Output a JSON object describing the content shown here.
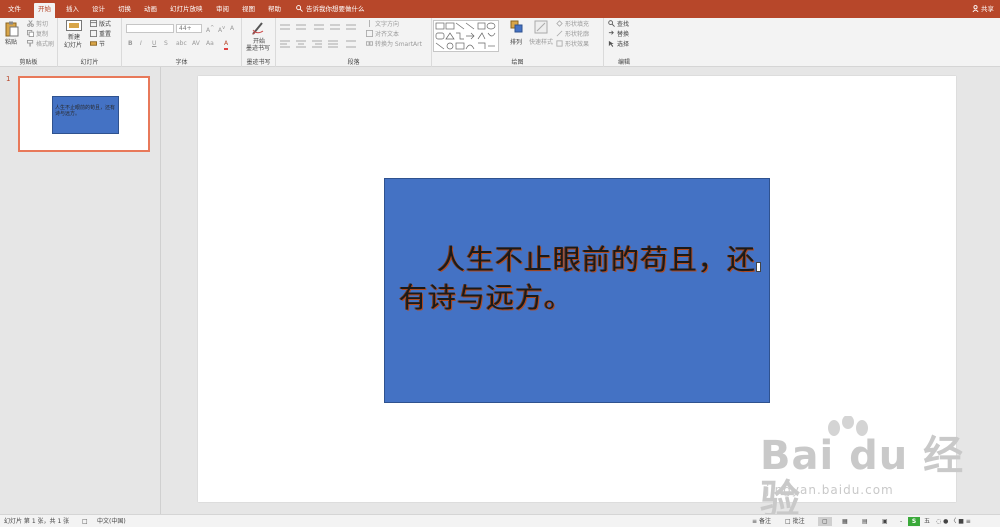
{
  "tabs": [
    "文件",
    "开始",
    "插入",
    "设计",
    "切换",
    "动画",
    "幻灯片放映",
    "审阅",
    "视图",
    "帮助"
  ],
  "active_tab": "开始",
  "tell_me": "告诉我你想要做什么",
  "share": "共享",
  "groups": {
    "clipboard": {
      "label": "剪贴板",
      "paste": "粘贴",
      "cut": "剪切",
      "copy": "复制",
      "format_painter": "格式刷"
    },
    "slides": {
      "label": "幻灯片",
      "new_slide_1": "新建",
      "new_slide_2": "幻灯片",
      "layout": "版式",
      "reset": "重置",
      "section": "节"
    },
    "font": {
      "label": "字体",
      "font_name": "",
      "font_size": "44+",
      "bold": "B",
      "italic": "I",
      "underline": "U",
      "strike": "S",
      "shadow": "abc",
      "spacing": "AV",
      "case": "Aa",
      "color": "A"
    },
    "ink": {
      "label": "墨迹书写",
      "start_1": "开始",
      "start_2": "墨迹书写"
    },
    "paragraph": {
      "label": "段落",
      "text_direction": "文字方向",
      "align_text": "对齐文本",
      "smartart": "转换为 SmartArt"
    },
    "drawing": {
      "label": "绘图",
      "arrange": "排列",
      "quick_styles": "快速样式",
      "shape_fill": "形状填充",
      "shape_outline": "形状轮廓",
      "shape_effects": "形状效果"
    },
    "editing": {
      "label": "编辑",
      "find": "查找",
      "replace": "替换",
      "select": "选择"
    }
  },
  "thumbnail": {
    "number": "1",
    "text": "人生不止眼前的苟且，还有诗与远方。"
  },
  "slide": {
    "text": "人生不止眼前的苟且，还有诗与远方。"
  },
  "status": {
    "slide_info": "幻灯片 第 1 张，共 1 张",
    "language": "中文(中国)",
    "notes": "备注",
    "comments": "批注",
    "zoom": "五"
  },
  "watermark": {
    "brand": "Bai du 经验",
    "url": "jingyan.baidu.com"
  },
  "colors": {
    "accent": "#b7472a",
    "shape_fill": "#4472c4",
    "shape_border": "#2f528f"
  }
}
